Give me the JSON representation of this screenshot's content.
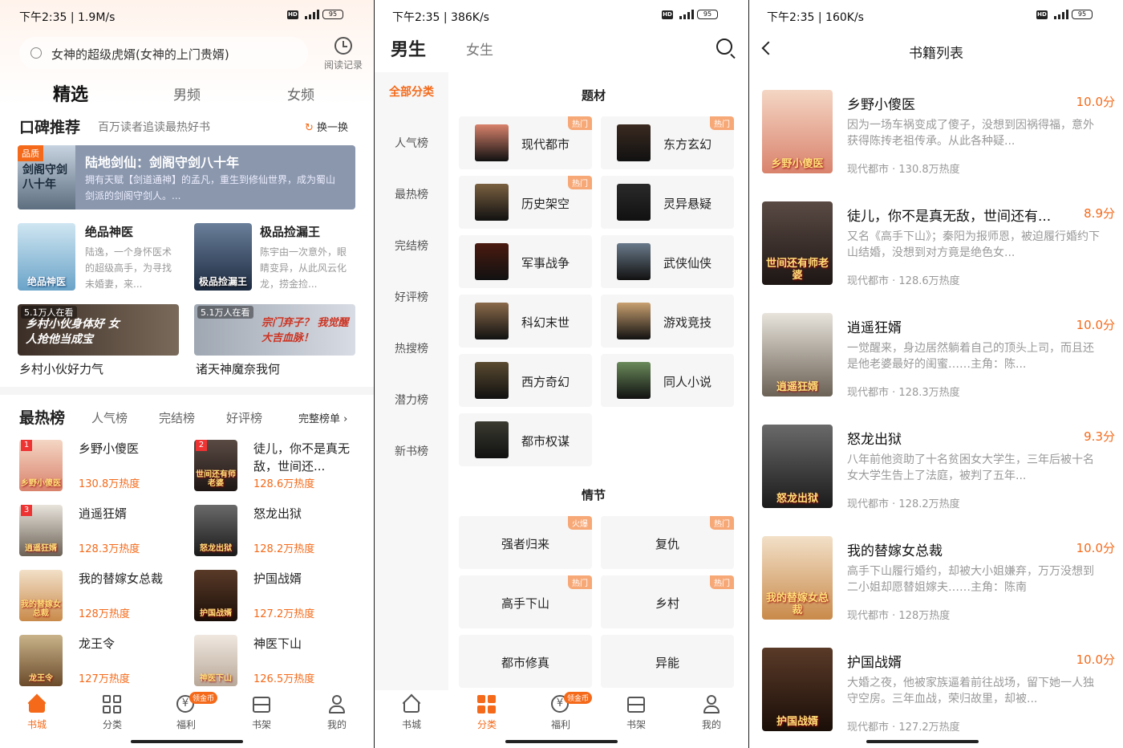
{
  "s1": {
    "status": "下午2:35 | 1.9M/s",
    "battery": "95",
    "search_text": "女神的超级虎婿(女神的上门贵婿)",
    "history_label": "阅读记录",
    "tabs": [
      "精选",
      "男频",
      "女频"
    ],
    "praise": {
      "title": "口碑推荐",
      "subtitle": "百万读者追读最热好书",
      "refresh": "换一换"
    },
    "banner": {
      "tag": "品质",
      "title": "陆地剑仙：剑阁守剑八十年",
      "desc": "拥有天赋【剑道通神】的孟凡，重生到修仙世界，成为蜀山剑派的剑阁守剑人。...",
      "cover_text": "剑阁守剑八十年"
    },
    "books": [
      {
        "title": "绝品神医",
        "desc": "陆逸，一个身怀医术的超级高手，为寻找未婚妻，来...",
        "cover_text": "绝品神医"
      },
      {
        "title": "极品捡漏王",
        "desc": "陈宇由一次意外，眼睛变异，从此风云化龙，捞金捡...",
        "cover_text": "极品捡漏王"
      }
    ],
    "feature": [
      {
        "viewers": "5.1万人在看",
        "caption": "乡村小伙好力气",
        "banner_text": "乡村小伙身体好 女人抢他当成宝"
      },
      {
        "viewers": "5.1万人在看",
        "caption": "诸天神魔奈我何",
        "banner_text": "宗门弃子？ 我觉醒大吉血脉！"
      }
    ],
    "hot": {
      "title": "最热榜",
      "tabs": [
        "人气榜",
        "完结榜",
        "好评榜"
      ],
      "full": "完整榜单 ›"
    },
    "rank": [
      {
        "n": "1",
        "title": "乡野小傻医",
        "heat": "130.8万热度",
        "cover": "乡野小傻医"
      },
      {
        "n": "2",
        "title": "徒儿，你不是真无敌，世间还...",
        "heat": "128.6万热度",
        "cover": "世间还有师老婆"
      },
      {
        "n": "3",
        "title": "逍遥狂婿",
        "heat": "128.3万热度",
        "cover": "逍遥狂婿"
      },
      {
        "n": "",
        "title": "怒龙出狱",
        "heat": "128.2万热度",
        "cover": "怒龙出狱"
      },
      {
        "n": "",
        "title": "我的替嫁女总裁",
        "heat": "128万热度",
        "cover": "我的替嫁女总裁"
      },
      {
        "n": "",
        "title": "护国战婿",
        "heat": "127.2万热度",
        "cover": "护国战婿"
      },
      {
        "n": "",
        "title": "龙王令",
        "heat": "127万热度",
        "cover": "龙王令"
      },
      {
        "n": "",
        "title": "神医下山",
        "heat": "126.5万热度",
        "cover": "神医下山"
      }
    ],
    "tabbar": [
      "书城",
      "分类",
      "福利",
      "书架",
      "我的"
    ],
    "coin_badge": "领金币"
  },
  "s2": {
    "status": "下午2:35 | 386K/s",
    "battery": "95",
    "top_tabs": [
      "男生",
      "女生"
    ],
    "side": [
      "全部分类",
      "人气榜",
      "最热榜",
      "完结榜",
      "好评榜",
      "热搜榜",
      "潜力榜",
      "新书榜"
    ],
    "genre_title": "题材",
    "genres": [
      {
        "label": "现代都市",
        "tag": "热门"
      },
      {
        "label": "东方玄幻",
        "tag": "热门"
      },
      {
        "label": "历史架空",
        "tag": "热门"
      },
      {
        "label": "灵异悬疑",
        "tag": ""
      },
      {
        "label": "军事战争",
        "tag": ""
      },
      {
        "label": "武侠仙侠",
        "tag": ""
      },
      {
        "label": "科幻末世",
        "tag": ""
      },
      {
        "label": "游戏竞技",
        "tag": ""
      },
      {
        "label": "西方奇幻",
        "tag": ""
      },
      {
        "label": "同人小说",
        "tag": ""
      },
      {
        "label": "都市权谋",
        "tag": ""
      }
    ],
    "plot_title": "情节",
    "plots": [
      {
        "label": "强者归来",
        "tag": "火爆"
      },
      {
        "label": "复仇",
        "tag": "热门"
      },
      {
        "label": "高手下山",
        "tag": "热门"
      },
      {
        "label": "乡村",
        "tag": "热门"
      },
      {
        "label": "都市修真",
        "tag": ""
      },
      {
        "label": "异能",
        "tag": ""
      }
    ],
    "tabbar": [
      "书城",
      "分类",
      "福利",
      "书架",
      "我的"
    ],
    "coin_badge": "领金币"
  },
  "s3": {
    "status": "下午2:35 | 160K/s",
    "battery": "95",
    "title": "书籍列表",
    "books": [
      {
        "title": "乡野小傻医",
        "score": "10.0分",
        "desc": "因为一场车祸变成了傻子，没想到因祸得福，意外获得陈抟老祖传承。从此各种疑...",
        "meta": "现代都市 · 130.8万热度",
        "cover": "乡野小傻医"
      },
      {
        "title": "徒儿，你不是真无敌，世间还有...",
        "score": "8.9分",
        "desc": "又名《高手下山》；秦阳为报师恩，被迫履行婚约下山结婚，没想到对方竟是绝色女...",
        "meta": "现代都市 · 128.6万热度",
        "cover": "世间还有师老婆"
      },
      {
        "title": "逍遥狂婿",
        "score": "10.0分",
        "desc": "一觉醒来，身边居然躺着自己的顶头上司，而且还是他老婆最好的闺蜜……主角：陈...",
        "meta": "现代都市 · 128.3万热度",
        "cover": "逍遥狂婿"
      },
      {
        "title": "怒龙出狱",
        "score": "9.3分",
        "desc": "八年前他资助了十名贫困女大学生，三年后被十名女大学生告上了法庭，被判了五年...",
        "meta": "现代都市 · 128.2万热度",
        "cover": "怒龙出狱"
      },
      {
        "title": "我的替嫁女总裁",
        "score": "10.0分",
        "desc": "高手下山履行婚约，却被大小姐嫌弃，万万没想到二小姐却愿替姐嫁夫……主角：陈南",
        "meta": "现代都市 · 128万热度",
        "cover": "我的替嫁女总裁"
      },
      {
        "title": "护国战婿",
        "score": "10.0分",
        "desc": "大婚之夜，他被家族逼着前往战场，留下她一人独守空房。三年血战，荣归故里，却被...",
        "meta": "现代都市 · 127.2万热度",
        "cover": "护国战婿"
      }
    ]
  },
  "colors": {
    "accent": "#f46a1a",
    "tag": "#f7a877",
    "banner_bg": "#8a97ad"
  }
}
